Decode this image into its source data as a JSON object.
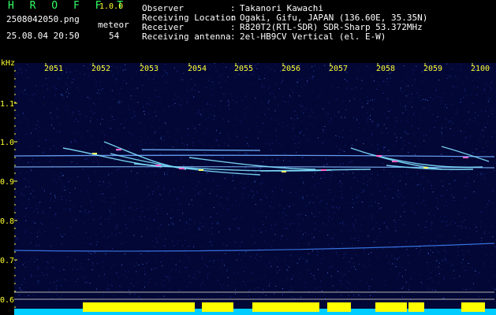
{
  "header": {
    "app_title": "H R O F F T",
    "app_version": "1.0.0",
    "file_name": "2508042050.png",
    "meteor_label": "meteor",
    "meteor_count": "54",
    "datetime": "25.08.04 20:50"
  },
  "info": [
    {
      "label": "Observer",
      "value": "Takanori Kawachi"
    },
    {
      "label": "Receiving Location",
      "value": "Ogaki, Gifu, JAPAN (136.60E, 35.35N)"
    },
    {
      "label": "Receiver",
      "value": "R820T2(RTL-SDR) SDR-Sharp 53.372MHz"
    },
    {
      "label": "Receiving antenna",
      "value": "2el-HB9CV Vertical (el. E-W)"
    }
  ],
  "axes": {
    "y_unit": "kHz",
    "y_ticks": [
      "1.1",
      "1.0",
      "0.9",
      "0.8",
      "0.7",
      "0.6"
    ],
    "x_ticks": [
      "2051",
      "2052",
      "2053",
      "2054",
      "2055",
      "2056",
      "2057",
      "2058",
      "2059",
      "2100"
    ]
  },
  "colors": {
    "background": "#000000",
    "plot_background": "#030735",
    "header_text": "#ffffff",
    "title_text": "#33ff66",
    "axis_text": "#ffff33",
    "trace": "#66ccff",
    "meteor_hot": "#ff66cc",
    "meteor_warm": "#ffff66",
    "bottom_bar": "#ffff00",
    "bottom_base": "#00ccff"
  }
}
